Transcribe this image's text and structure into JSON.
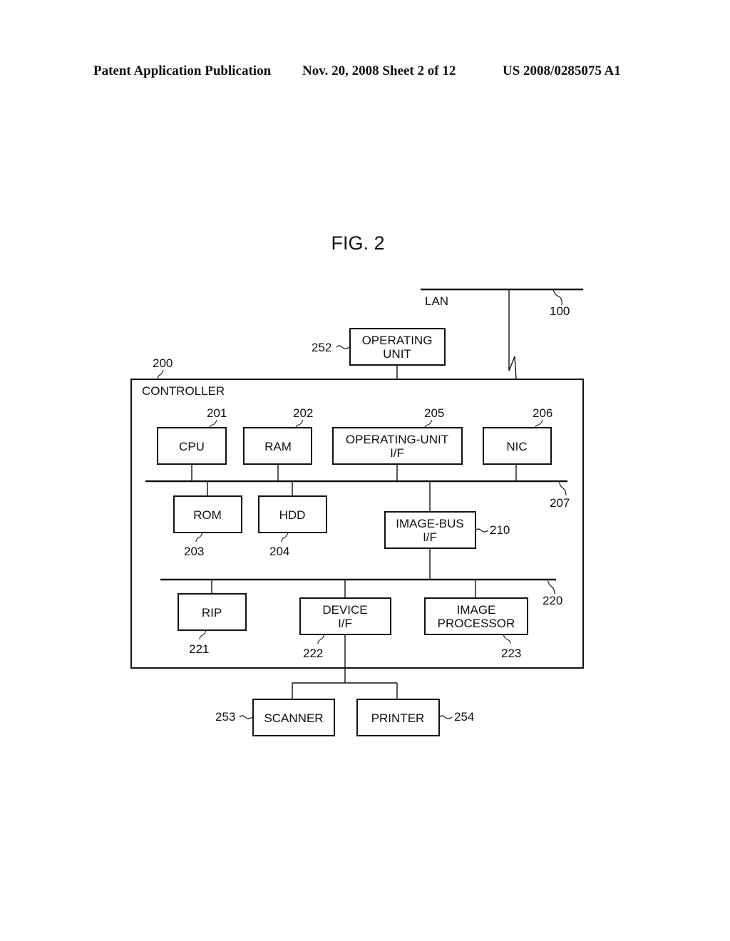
{
  "header": {
    "left": "Patent Application Publication",
    "date_sheet": "Nov. 20, 2008   Sheet 2 of 12",
    "number": "US 2008/0285075 A1"
  },
  "figure": {
    "title": "FIG. 2",
    "lan": {
      "label": "LAN",
      "ref": "100"
    },
    "controller": {
      "label": "CONTROLLER",
      "ref": "200"
    },
    "operating_unit": {
      "line1": "OPERATING",
      "line2": "UNIT",
      "ref": "252"
    },
    "cpu": {
      "label": "CPU",
      "ref": "201"
    },
    "ram": {
      "label": "RAM",
      "ref": "202"
    },
    "operating_unit_if": {
      "line1": "OPERATING-UNIT",
      "line2": "I/F",
      "ref": "205"
    },
    "nic": {
      "label": "NIC",
      "ref": "206"
    },
    "system_bus": {
      "ref": "207"
    },
    "rom": {
      "label": "ROM",
      "ref": "203"
    },
    "hdd": {
      "label": "HDD",
      "ref": "204"
    },
    "image_bus_if": {
      "line1": "IMAGE-BUS",
      "line2": "I/F",
      "ref": "210"
    },
    "image_bus": {
      "ref": "220"
    },
    "rip": {
      "label": "RIP",
      "ref": "221"
    },
    "device_if": {
      "line1": "DEVICE",
      "line2": "I/F",
      "ref": "222"
    },
    "image_processor": {
      "line1": "IMAGE",
      "line2": "PROCESSOR",
      "ref": "223"
    },
    "scanner": {
      "label": "SCANNER",
      "ref": "253"
    },
    "printer": {
      "label": "PRINTER",
      "ref": "254"
    }
  }
}
